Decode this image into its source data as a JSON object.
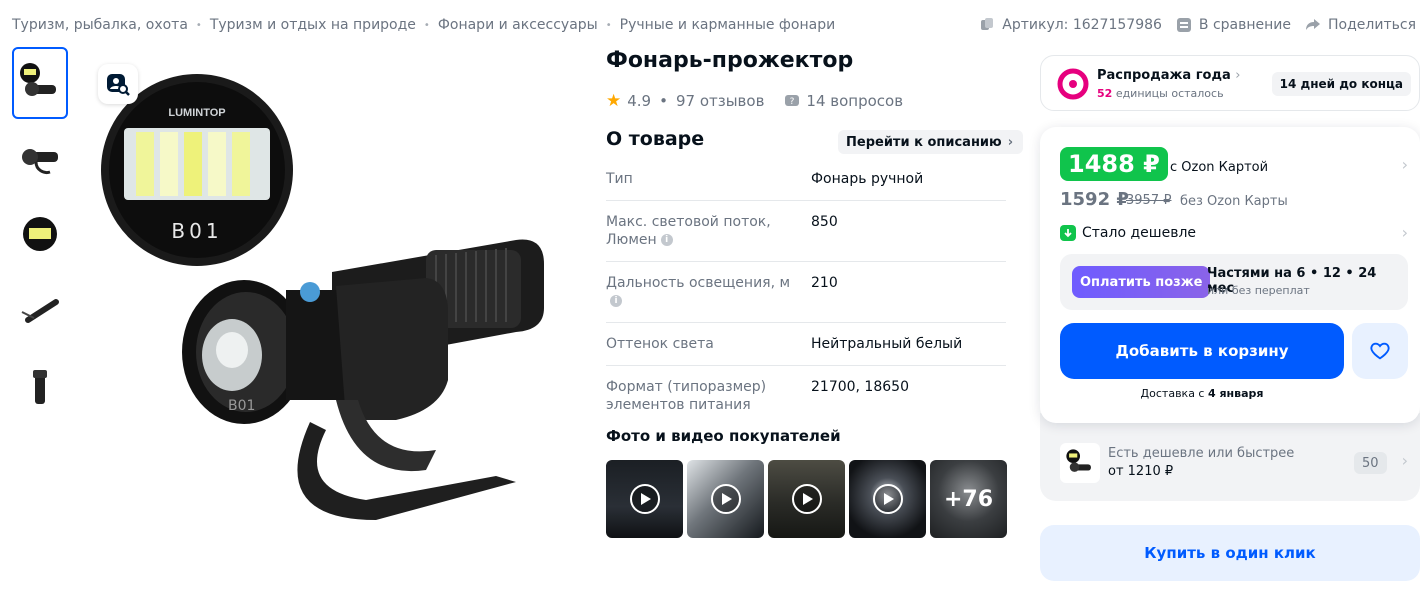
{
  "breadcrumbs": [
    "Туризм, рыбалка, охота",
    "Туризм и отдых на природе",
    "Фонари и аксессуары",
    "Ручные и карманные фонари"
  ],
  "topright": {
    "article": "Артикул: 1627157986",
    "compare": "В сравнение",
    "share": "Поделиться"
  },
  "product": {
    "title": "Фонарь-прожектор",
    "rating": "4.9",
    "reviews": "97 отзывов",
    "questions": "14 вопросов",
    "brand_on_image": "LUMINTOP",
    "model_on_image": "B01"
  },
  "about": {
    "title": "О товаре",
    "goto_label": "Перейти к описанию",
    "specs": [
      {
        "key": "Тип",
        "value": "Фонарь ручной"
      },
      {
        "key": "Макс. световой поток, Люмен",
        "value": "850"
      },
      {
        "key": "Дальность освещения, м",
        "value": "210"
      },
      {
        "key": "Оттенок света",
        "value": "Нейтральный белый"
      },
      {
        "key": "Формат (типоразмер) элементов питания",
        "value": "21700, 18650"
      }
    ]
  },
  "photos": {
    "title": "Фото и видео покупателей",
    "more": "+76"
  },
  "sale": {
    "title": "Распродажа года",
    "count": "52",
    "sub": "единицы осталось",
    "badge": "14 дней до конца"
  },
  "pricing": {
    "card_price": "1488 ₽",
    "card_label": "с Ozon Картой",
    "price": "1592 ₽",
    "old_price": "3957 ₽",
    "nocard_label": "без Ozon Карты",
    "cheaper": "Стало дешевле"
  },
  "paylater": {
    "button": "Оплатить позже",
    "title": "Частями на 6 • 12 • 24 мес",
    "sub": "или без переплат"
  },
  "cart": {
    "add": "Добавить в корзину",
    "delivery_prefix": "Доставка с ",
    "delivery_date": "4 января"
  },
  "alt": {
    "title": "Есть дешевле или быстрее",
    "price": "от 1210 ₽",
    "count": "50"
  },
  "oneclick": "Купить в один клик",
  "colors": {
    "accent": "#005bff",
    "green": "#10c44c",
    "pink": "#e6007e"
  }
}
